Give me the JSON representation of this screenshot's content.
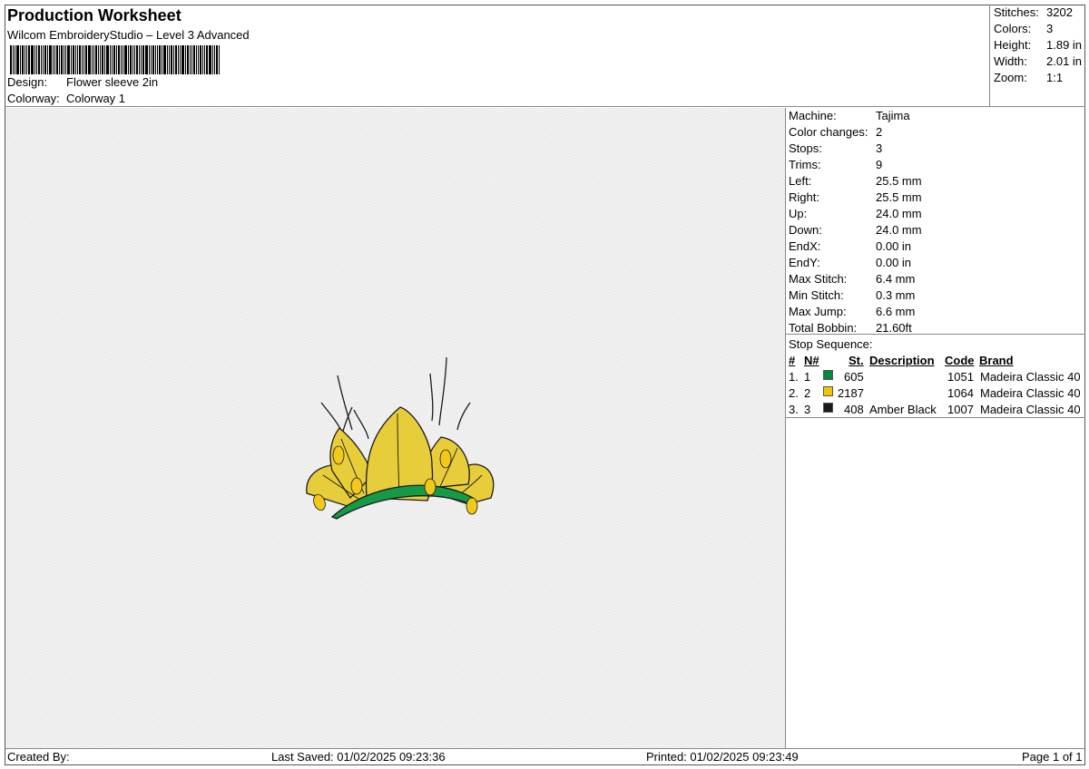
{
  "header": {
    "title": "Production Worksheet",
    "subtitle": "Wilcom EmbroideryStudio – Level 3 Advanced",
    "design_label": "Design:",
    "design_value": "Flower sleeve 2in",
    "colorway_label": "Colorway:",
    "colorway_value": "Colorway 1"
  },
  "summary": [
    {
      "label": "Stitches:",
      "value": "3202"
    },
    {
      "label": "Colors:",
      "value": "3"
    },
    {
      "label": "Height:",
      "value": "1.89 in"
    },
    {
      "label": "Width:",
      "value": "2.01 in"
    },
    {
      "label": "Zoom:",
      "value": "1:1"
    }
  ],
  "machine": [
    {
      "label": "Machine:",
      "value": "Tajima"
    },
    {
      "label": "Color changes:",
      "value": "2"
    },
    {
      "label": "Stops:",
      "value": "3"
    },
    {
      "label": "Trims:",
      "value": "9"
    },
    {
      "label": "Left:",
      "value": "25.5 mm"
    },
    {
      "label": "Right:",
      "value": "25.5 mm"
    },
    {
      "label": "Up:",
      "value": "24.0 mm"
    },
    {
      "label": "Down:",
      "value": "24.0 mm"
    },
    {
      "label": "EndX:",
      "value": "0.00 in"
    },
    {
      "label": "EndY:",
      "value": "0.00 in"
    },
    {
      "label": "Max Stitch:",
      "value": "6.4 mm"
    },
    {
      "label": "Min Stitch:",
      "value": "0.3 mm"
    },
    {
      "label": "Max Jump:",
      "value": "6.6 mm"
    },
    {
      "label": "Total Bobbin:",
      "value": "21.60ft"
    }
  ],
  "stops": {
    "caption": "Stop Sequence:",
    "headers": {
      "num": "#",
      "n": "N#",
      "st": "St.",
      "desc": "Description",
      "code": "Code",
      "brand": "Brand"
    },
    "rows": [
      {
        "num": "1.",
        "n": "1",
        "color": "#008a3e",
        "st": "605",
        "desc": "",
        "code": "1051",
        "brand": "Madeira Classic 40"
      },
      {
        "num": "2.",
        "n": "2",
        "color": "#f5c400",
        "st": "2187",
        "desc": "",
        "code": "1064",
        "brand": "Madeira Classic 40"
      },
      {
        "num": "3.",
        "n": "3",
        "color": "#1a1a1a",
        "st": "408",
        "desc": "Amber Black",
        "code": "1007",
        "brand": "Madeira Classic 40"
      }
    ]
  },
  "footer": {
    "created": "Created By:",
    "saved": "Last Saved: 01/02/2025 09:23:36",
    "printed": "Printed: 01/02/2025 09:23:49",
    "page": "Page 1 of 1"
  },
  "colors": {
    "leaf_yellow": "#e8cd3a",
    "bud_yellow": "#f2c81a",
    "green": "#159a48",
    "outline": "#1a1a1a"
  }
}
